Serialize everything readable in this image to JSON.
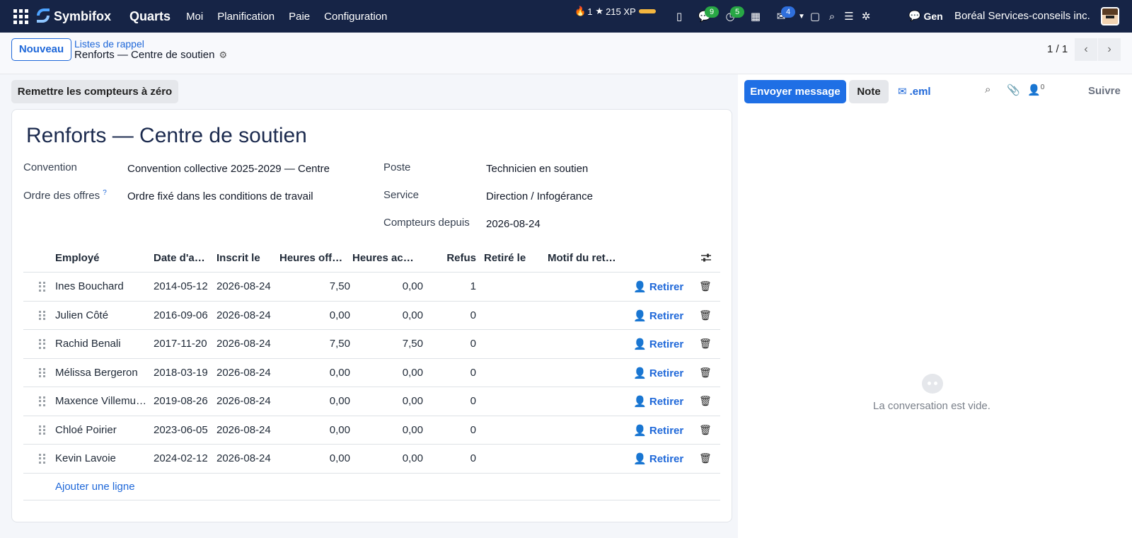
{
  "topbar": {
    "brand": "Symbifox",
    "app": "Quarts",
    "menu": [
      "Moi",
      "Planification",
      "Paie",
      "Configuration"
    ],
    "streak": "1",
    "xp": "215 XP",
    "badges": {
      "chat": "9",
      "activities": "5",
      "inbox": "4"
    },
    "gen_label": "Gen",
    "company": "Boréal Services-conseils inc."
  },
  "control": {
    "new_label": "Nouveau",
    "breadcrumb_parent": "Listes de rappel",
    "breadcrumb_current": "Renforts — Centre de soutien",
    "pager": "1 / 1"
  },
  "status": {
    "reset_label": "Remettre les compteurs à zéro"
  },
  "form": {
    "title": "Renforts — Centre de soutien",
    "fields": {
      "convention_label": "Convention",
      "convention_value": "Convention collective 2025-2029 — Centre",
      "ordre_label": "Ordre des offres",
      "ordre_help": "?",
      "ordre_value": "Ordre fixé dans les conditions de travail",
      "poste_label": "Poste",
      "poste_value": "Technicien en soutien",
      "service_label": "Service",
      "service_value": "Direction / Infogérance",
      "compteurs_label": "Compteurs depuis",
      "compteurs_value": "2026-08-24"
    }
  },
  "table": {
    "headers": [
      "Employé",
      "Date d'an…",
      "Inscrit le",
      "Heures off…",
      "Heures acc…",
      "Refus",
      "Retiré le",
      "Motif du retr…"
    ],
    "rows": [
      {
        "name": "Ines Bouchard",
        "date": "2014-05-12",
        "inscrit": "2026-08-24",
        "off": "7,50",
        "acc": "0,00",
        "refus": "1"
      },
      {
        "name": "Julien Côté",
        "date": "2016-09-06",
        "inscrit": "2026-08-24",
        "off": "0,00",
        "acc": "0,00",
        "refus": "0"
      },
      {
        "name": "Rachid Benali",
        "date": "2017-11-20",
        "inscrit": "2026-08-24",
        "off": "7,50",
        "acc": "7,50",
        "refus": "0"
      },
      {
        "name": "Mélissa Bergeron",
        "date": "2018-03-19",
        "inscrit": "2026-08-24",
        "off": "0,00",
        "acc": "0,00",
        "refus": "0"
      },
      {
        "name": "Maxence Villemu…",
        "date": "2019-08-26",
        "inscrit": "2026-08-24",
        "off": "0,00",
        "acc": "0,00",
        "refus": "0"
      },
      {
        "name": "Chloé Poirier",
        "date": "2023-06-05",
        "inscrit": "2026-08-24",
        "off": "0,00",
        "acc": "0,00",
        "refus": "0"
      },
      {
        "name": "Kevin Lavoie",
        "date": "2024-02-12",
        "inscrit": "2026-08-24",
        "off": "0,00",
        "acc": "0,00",
        "refus": "0"
      }
    ],
    "action_label": "Retirer",
    "add_line": "Ajouter une ligne"
  },
  "chatter": {
    "send_label": "Envoyer message",
    "note_label": "Note",
    "eml_label": ".eml",
    "followers_count": "0",
    "follow_label": "Suivre",
    "empty_text": "La conversation est vide."
  },
  "colors": {
    "nav_bg": "#162446",
    "accent": "#1f68d9",
    "primary_btn": "#1f6fe5"
  }
}
